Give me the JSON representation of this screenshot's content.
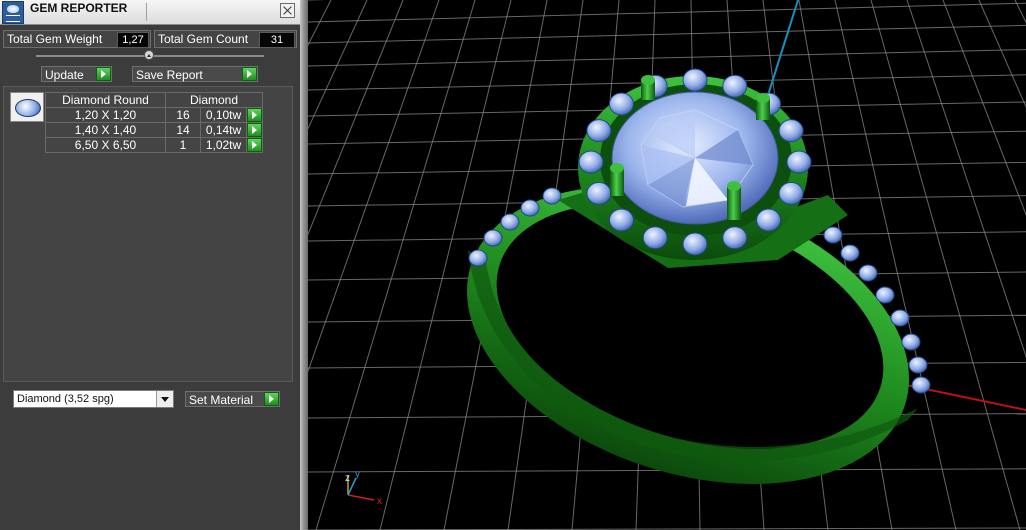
{
  "window": {
    "title": "GEM REPORTER",
    "close_icon": "close-icon"
  },
  "stats": {
    "total_weight_label": "Total Gem Weight",
    "total_weight_value": "1,27",
    "total_count_label": "Total Gem Count",
    "total_count_value": "31"
  },
  "actions": {
    "update_label": "Update",
    "save_report_label": "Save Report"
  },
  "table": {
    "headers": [
      "Diamond Round",
      "Diamond"
    ],
    "rows": [
      {
        "size": "1,20 X 1,20",
        "count": "16",
        "weight": "0,10tw"
      },
      {
        "size": "1,40 X 1,40",
        "count": "14",
        "weight": "0,14tw"
      },
      {
        "size": "6,50 X 6,50",
        "count": "1",
        "weight": "1,02tw"
      }
    ]
  },
  "material": {
    "selected": "Diamond     (3,52 spg)",
    "set_label": "Set Material"
  },
  "viewport": {
    "axis_labels": {
      "x": "x",
      "y": "y",
      "z": "z"
    },
    "colors": {
      "metal": "#1e8a1e",
      "gem": "#9ab4ec",
      "x_axis": "#c01010",
      "y_axis": "#1a8fc4",
      "grid": "#8a8a8a"
    }
  }
}
